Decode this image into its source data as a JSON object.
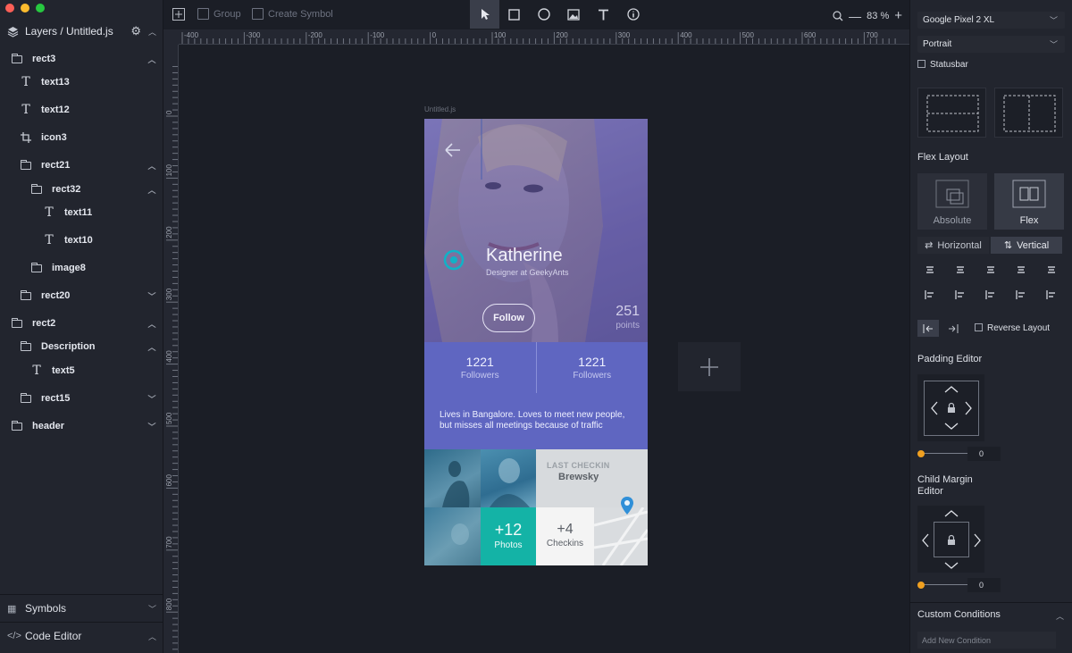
{
  "sidebar": {
    "title": "Layers / Untitled.js",
    "layers": [
      {
        "label": "rect3",
        "type": "folder",
        "chevron": "up"
      },
      {
        "label": "text13",
        "type": "text"
      },
      {
        "label": "text12",
        "type": "text"
      },
      {
        "label": "icon3",
        "type": "icon"
      },
      {
        "label": "rect21",
        "type": "folder",
        "chevron": "up"
      },
      {
        "label": "rect32",
        "type": "folder",
        "chevron": "up"
      },
      {
        "label": "text11",
        "type": "text"
      },
      {
        "label": "text10",
        "type": "text"
      },
      {
        "label": "image8",
        "type": "folder"
      },
      {
        "label": "rect20",
        "type": "folder",
        "chevron": "down"
      },
      {
        "label": "rect2",
        "type": "folder",
        "chevron": "up"
      },
      {
        "label": "Description",
        "type": "folder",
        "chevron": "up"
      },
      {
        "label": "text5",
        "type": "text"
      },
      {
        "label": "rect15",
        "type": "folder",
        "chevron": "down"
      },
      {
        "label": "header",
        "type": "folder",
        "chevron": "down"
      }
    ],
    "symbols_label": "Symbols",
    "code_editor_label": "Code Editor"
  },
  "toolbar": {
    "group_label": "Group",
    "create_symbol_label": "Create Symbol",
    "zoom_value": "83 %"
  },
  "rulers": {
    "h_ticks": [
      "-400",
      "-300",
      "-200",
      "-100",
      "0",
      "100",
      "200",
      "300",
      "400",
      "500",
      "600",
      "700"
    ],
    "v_ticks": [
      "0",
      "100",
      "200",
      "300",
      "400",
      "500",
      "600",
      "700",
      "800"
    ]
  },
  "canvas": {
    "file_label": "Untitled.js",
    "profile": {
      "name": "Katherine",
      "subtitle": "Designer at GeekyAnts",
      "follow_label": "Follow",
      "points_value": "251",
      "points_label": "points"
    },
    "stats": [
      {
        "value": "1221",
        "label": "Followers"
      },
      {
        "value": "1221",
        "label": "Followers"
      }
    ],
    "description": "Lives in Bangalore. Loves to meet new people, but misses all meetings because of traffic",
    "last_checkin_label": "LAST CHECKIN",
    "last_checkin_place": "Brewsky",
    "photos_count": "+12",
    "photos_label": "Photos",
    "checkins_count": "+4",
    "checkins_label": "Checkins"
  },
  "inspector": {
    "device": "Google Pixel 2 XL",
    "orientation": "Portrait",
    "statusbar_label": "Statusbar",
    "flex_layout_label": "Flex Layout",
    "absolute_label": "Absolute",
    "flex_label": "Flex",
    "horizontal_label": "Horizontal",
    "vertical_label": "Vertical",
    "reverse_layout_label": "Reverse Layout",
    "padding_editor_label": "Padding Editor",
    "padding_value": "0",
    "child_margin_label": "Child Margin Editor",
    "child_margin_value": "0",
    "custom_conditions_label": "Custom Conditions",
    "add_condition_placeholder": "Add New Condition"
  },
  "colors": {
    "accent_orange": "#f0a020",
    "card_purple": "#5f66c1",
    "teal": "#17b2a6"
  }
}
